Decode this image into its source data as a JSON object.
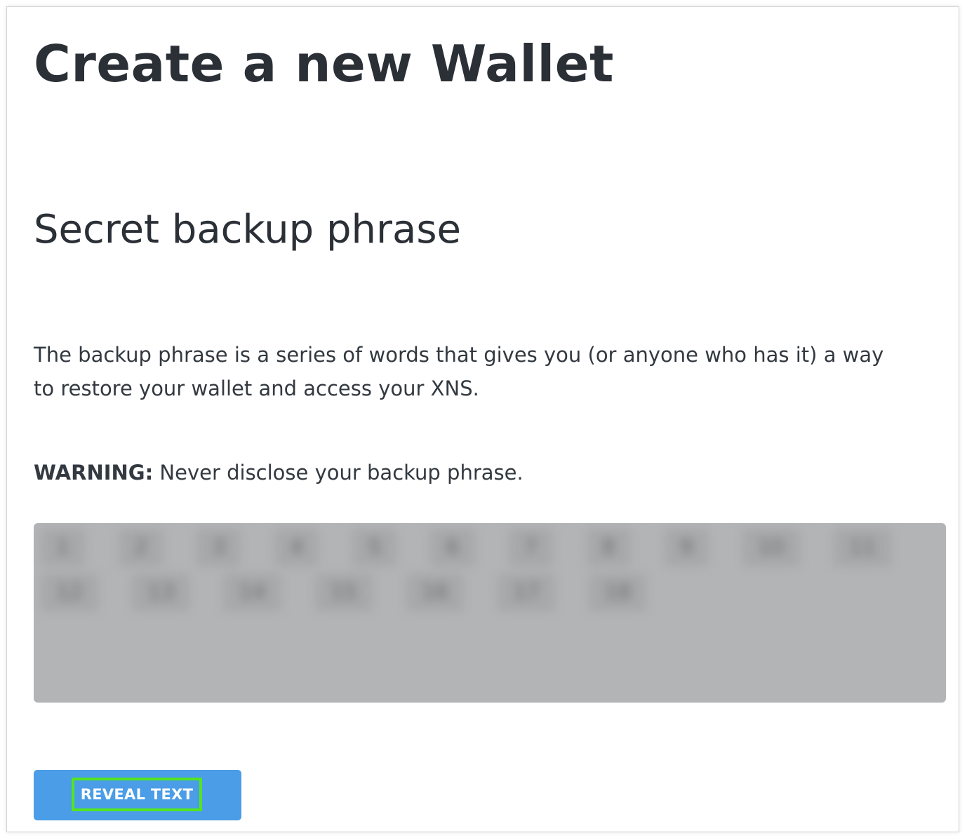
{
  "page": {
    "title": "Create a new Wallet",
    "section_title": "Secret backup phrase",
    "description": "The backup phrase is a series of words that gives you (or anyone who has it) a way to restore your wallet and access your XNS.",
    "warning_label": "WARNING:",
    "warning_text": " Never disclose your backup phrase."
  },
  "phrase": {
    "words": [
      {
        "index": "1"
      },
      {
        "index": "2"
      },
      {
        "index": "3"
      },
      {
        "index": "4"
      },
      {
        "index": "5"
      },
      {
        "index": "6"
      },
      {
        "index": "7"
      },
      {
        "index": "8"
      },
      {
        "index": "9"
      },
      {
        "index": "10"
      },
      {
        "index": "11"
      },
      {
        "index": "12"
      },
      {
        "index": "13"
      },
      {
        "index": "14"
      },
      {
        "index": "15"
      },
      {
        "index": "16"
      },
      {
        "index": "17"
      },
      {
        "index": "18"
      }
    ]
  },
  "reveal_button": {
    "label": "REVEAL TEXT"
  },
  "colors": {
    "button": "#4a9de6",
    "highlight": "#53e51f",
    "phrase_box": "#b3b4b6",
    "text": "#2b3037"
  }
}
